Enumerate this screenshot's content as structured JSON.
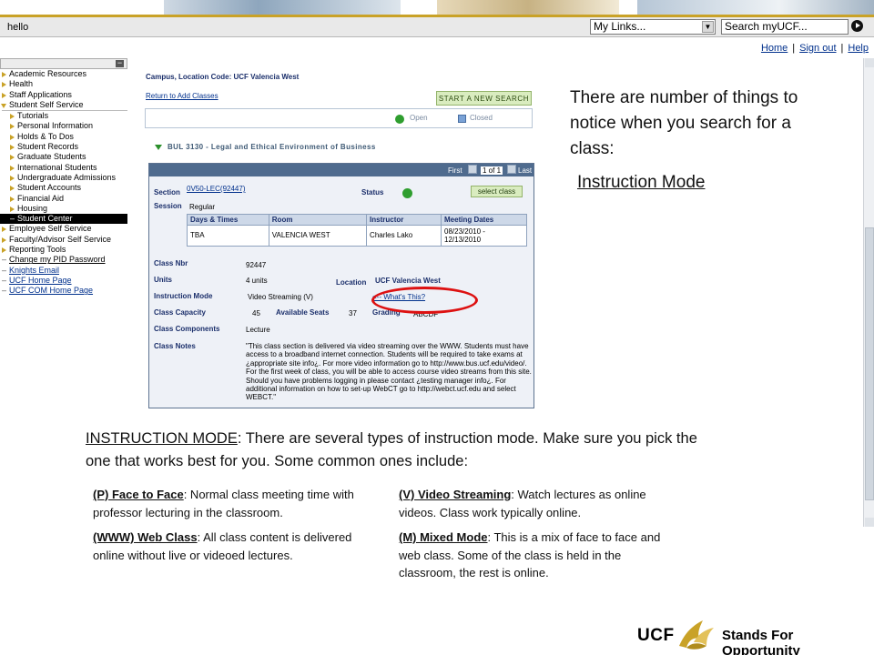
{
  "topbar": {
    "greeting": "hello",
    "my_links": "My Links...",
    "search_placeholder": "Search myUCF..."
  },
  "toplinks": {
    "home": "Home",
    "sign_out": "Sign out",
    "help": "Help"
  },
  "nav": {
    "items": [
      "Academic Resources",
      "Health",
      "Staff Applications",
      "Student Self Service",
      "Tutorials",
      "Personal Information",
      "Holds & To Dos",
      "Student Records",
      "Graduate Students",
      "International Students",
      "Undergraduate Admissions",
      "Student Accounts",
      "Financial Aid",
      "Housing",
      "Student Center",
      "Employee Self Service",
      "Faculty/Advisor Self Service",
      "Reporting Tools",
      "Change my PID Password",
      "Knights Email",
      "UCF Home Page",
      "UCF COM Home Page"
    ]
  },
  "search_results": {
    "campus_label": "Campus, Location Code:",
    "campus_value": "UCF Valencia West",
    "return_link": "Return to Add Classes",
    "start_button": "START A NEW SEARCH",
    "legend_open": "Open",
    "legend_closed": "Closed",
    "course_title": "BUL 3130 - Legal and Ethical Environment of Business",
    "pager_first": "First",
    "pager_of": "1 of 1",
    "pager_last": "Last",
    "section_label": "Section",
    "section_value": "0V50-LEC(92447)",
    "status_label": "Status",
    "select_button": "select class",
    "session_label": "Session",
    "session_value": "Regular",
    "table_headers": [
      "Days & Times",
      "Room",
      "Instructor",
      "Meeting Dates"
    ],
    "table_row": [
      "TBA",
      "VALENCIA WEST",
      "Charles Lako",
      "08/23/2010 - 12/13/2010"
    ],
    "class_nbr_label": "Class Nbr",
    "class_nbr_value": "92447",
    "units_label": "Units",
    "units_value": "4 units",
    "location_label": "Location",
    "location_value": "UCF Valencia West",
    "mode_label": "Instruction Mode",
    "mode_value": "Video Streaming (V)",
    "whats_this": "<-- What's This?",
    "capacity_label": "Class Capacity",
    "capacity_value": "45",
    "seats_label": "Available Seats",
    "seats_value": "37",
    "grading_label": "Grading",
    "grading_value": "ABCDF",
    "components_label": "Class Components",
    "components_value": "Lecture",
    "notes_label": "Class Notes",
    "notes_value": "\"This class section is delivered via video streaming over the WWW. Students must have access to a broadband internet connection. Students will be required to take exams at ¿appropriate site info¿. For more video information go to http://www.bus.ucf.edu/video/. For the first week of class, you will be able to access course video streams from this site. Should you have problems logging in please contact ¿testing manager info¿. For additional information on how to set-up WebCT go to http://webct.ucf.edu and select WEBCT.\""
  },
  "intro": {
    "text": "There are number of things to notice when you search for a class:",
    "link": "Instruction Mode"
  },
  "explanation": {
    "term": "INSTRUCTION MODE",
    "text": ": There are several types of instruction mode. Make sure you pick the one that works best for you. Some common ones include:"
  },
  "modes": [
    {
      "term": "(P) Face to Face",
      "desc": ": Normal class meeting time with professor lecturing in the classroom."
    },
    {
      "term": "(V) Video Streaming",
      "desc": ": Watch lectures as online videos. Class work typically online."
    },
    {
      "term": "(WWW) Web Class",
      "desc": ": All class content is delivered online without live or videoed lectures."
    },
    {
      "term": "(M) Mixed Mode",
      "desc": ": This is a mix of face to face and web class. Some of the class is held in the classroom, the rest is online."
    }
  ],
  "footer": {
    "logo": "UCF",
    "tagline": "Stands For Opportunity"
  },
  "colors": {
    "ucf_gold": "#c9a227",
    "link_blue": "#00308c",
    "open_green": "#2f9e2f",
    "highlight_red": "#d11111"
  }
}
